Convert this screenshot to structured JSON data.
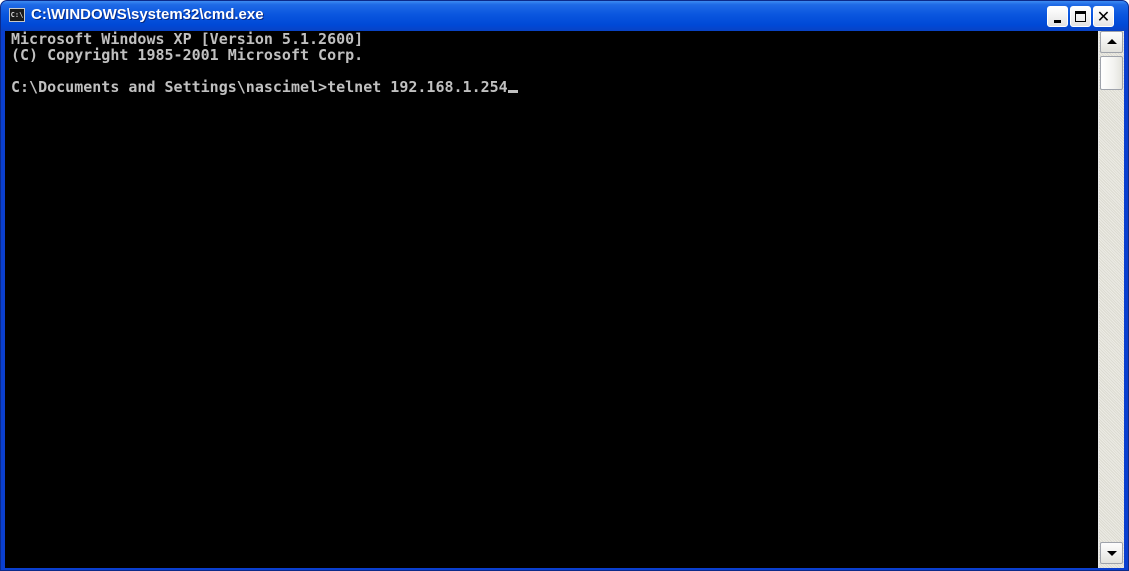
{
  "window": {
    "title": "C:\\WINDOWS\\system32\\cmd.exe",
    "icon_text": "C:\\",
    "icon": "console-app-icon",
    "controls": [
      "minimize-icon",
      "maximize-icon",
      "close-icon"
    ]
  },
  "console": {
    "lines": [
      "Microsoft Windows XP [Version 5.1.2600]",
      "(C) Copyright 1985-2001 Microsoft Corp.",
      "",
      "C:\\Documents and Settings\\nascimel>telnet 192.168.1.254"
    ],
    "text_color": "#c0c0c0",
    "background": "#000000"
  },
  "colors": {
    "titlebar": "#0054e3",
    "window_border": "#0a3fcf"
  }
}
